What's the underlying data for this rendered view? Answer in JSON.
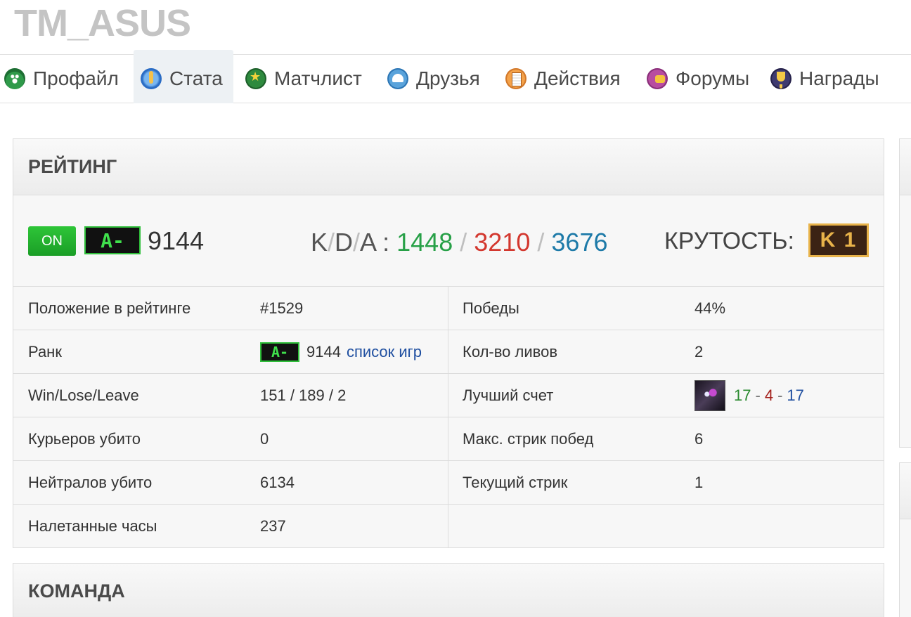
{
  "profile": {
    "username": "TM_ASUS"
  },
  "tabs": [
    {
      "label": "Профайл",
      "icon": "profile-icon"
    },
    {
      "label": "Стата",
      "icon": "stats-icon",
      "active": true
    },
    {
      "label": "Матчлист",
      "icon": "matchlist-icon"
    },
    {
      "label": "Друзья",
      "icon": "friends-icon"
    },
    {
      "label": "Действия",
      "icon": "actions-icon"
    },
    {
      "label": "Форумы",
      "icon": "forums-icon"
    },
    {
      "label": "Награды",
      "icon": "awards-icon"
    }
  ],
  "rating": {
    "title": "РЕЙТИНГ",
    "status": "ON",
    "rank": "A-",
    "value": "9144",
    "kda": {
      "label_k": "K",
      "label_d": "D",
      "label_a": "A",
      "colon": ":",
      "slash": "/",
      "kills": "1448",
      "deaths": "3210",
      "assists": "3676"
    },
    "coolness": {
      "label": "КРУТОСТЬ:",
      "value": "K 1"
    },
    "stats": [
      {
        "label": "Положение в рейтинге",
        "value": "#1529"
      },
      {
        "label": "Ранк",
        "rank": "A-",
        "value": "9144",
        "link": "список игр"
      },
      {
        "label": "Win/Lose/Leave",
        "value": "151 / 189 / 2"
      },
      {
        "label": "Курьеров убито",
        "value": "0"
      },
      {
        "label": "Нейтралов убито",
        "value": "6134"
      },
      {
        "label": "Налетанные часы",
        "value": "237"
      }
    ],
    "stats_right": [
      {
        "label": "Победы",
        "value": "44%"
      },
      {
        "label": "Кол-во ливов",
        "value": "2"
      },
      {
        "label": "Лучший счет",
        "kills": "17",
        "deaths": "4",
        "assists": "17",
        "dash": "-"
      },
      {
        "label": "Макс. стрик побед",
        "value": "6"
      },
      {
        "label": "Текущий стрик",
        "value": "1"
      }
    ]
  },
  "team": {
    "title": "КОМАНДА"
  },
  "colors": {
    "kills": "#27a047",
    "deaths": "#d3372e",
    "assists": "#1d7aa8",
    "on": "#2ec538",
    "rank_green": "#3fe04c",
    "coolness_gold": "#e8b34a"
  }
}
